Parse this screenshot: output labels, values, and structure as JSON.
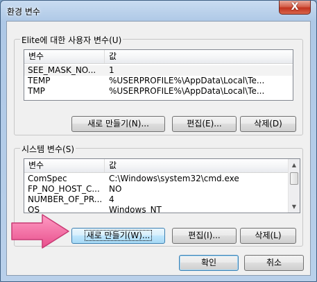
{
  "window": {
    "title": "환경 변수",
    "close_glyph": "X"
  },
  "user_vars": {
    "group_label": "Elite에 대한 사용자 변수(U)",
    "columns": [
      "변수",
      "값"
    ],
    "rows": [
      {
        "name": "SEE_MASK_NO...",
        "value": "1"
      },
      {
        "name": "TEMP",
        "value": "%USERPROFILE%\\AppData\\Local\\Te..."
      },
      {
        "name": "TMP",
        "value": "%USERPROFILE%\\AppData\\Local\\Te..."
      }
    ],
    "buttons": {
      "new": "새로 만들기(N)...",
      "edit": "편집(E)...",
      "delete": "삭제(D)"
    }
  },
  "system_vars": {
    "group_label": "시스템 변수(S)",
    "columns": [
      "변수",
      "값"
    ],
    "rows": [
      {
        "name": "ComSpec",
        "value": "C:\\Windows\\system32\\cmd.exe"
      },
      {
        "name": "FP_NO_HOST_C...",
        "value": "NO"
      },
      {
        "name": "NUMBER_OF_PR...",
        "value": "4"
      },
      {
        "name": "OS",
        "value": "Windows_NT"
      }
    ],
    "buttons": {
      "new": "새로 만들기(W)...",
      "edit": "편집(I)...",
      "delete": "삭제(L)"
    }
  },
  "footer": {
    "ok": "확인",
    "cancel": "취소"
  },
  "colors": {
    "arrow": "#f06aa0",
    "accent": "#3c7fb1"
  },
  "icons": {
    "arrow": "pink-pointer-arrow-icon",
    "scroll_up": "scroll-up-arrow-icon",
    "scroll_down": "scroll-down-arrow-icon"
  }
}
